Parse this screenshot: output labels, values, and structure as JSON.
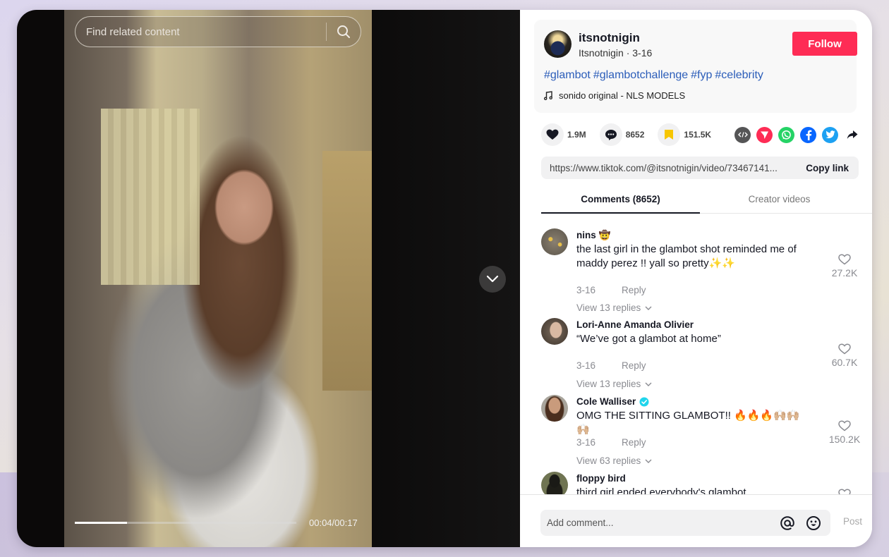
{
  "video": {
    "search_placeholder": "Find related content",
    "time_display": "00:04/00:17",
    "progress_fraction": 0.235
  },
  "post": {
    "author_name": "itsnotnigin",
    "author_sub": "Itsnotnigin · 3-16",
    "follow_label": "Follow",
    "hashtags": [
      "#glambot",
      "#glambotchallenge",
      "#fyp",
      "#celebrity"
    ],
    "music": "sonido original - NLS MODELS"
  },
  "stats": {
    "likes": "1.9M",
    "comments": "8652",
    "saves": "151.5K"
  },
  "share": {
    "icons": [
      "embed-icon",
      "send-to-friends-icon",
      "whatsapp-icon",
      "facebook-icon",
      "twitter-icon",
      "share-arrow-icon"
    ]
  },
  "link": {
    "url": "https://www.tiktok.com/@itsnotnigin/video/73467141...",
    "copy_label": "Copy link"
  },
  "tabs": [
    {
      "label": "Comments (8652)",
      "active": true
    },
    {
      "label": "Creator videos",
      "active": false
    }
  ],
  "comments": [
    {
      "user": "nins 🤠",
      "text": "the last girl in the glambot shot reminded me of maddy perez !! yall so pretty✨✨",
      "date": "3-16",
      "reply": "Reply",
      "view_replies": "View 13 replies",
      "likes": "27.2K"
    },
    {
      "user": "Lori-Anne Amanda Olivier",
      "text": "“We’ve got a glambot at home”",
      "date": "3-16",
      "reply": "Reply",
      "view_replies": "View 13 replies",
      "likes": "60.7K"
    },
    {
      "user": "Cole Walliser",
      "verified": true,
      "text": "OMG THE SITTING GLAMBOT!! 🔥🔥🔥🙌🏼🙌🏼🙌🏼",
      "date": "3-16",
      "reply": "Reply",
      "view_replies": "View 63 replies",
      "likes": "150.2K"
    },
    {
      "user": "floppy bird",
      "text": "third girl ended everybody's glambot"
    }
  ],
  "comment_bar": {
    "placeholder": "Add comment...",
    "post_label": "Post"
  },
  "colors": {
    "brand_red": "#fe2c55",
    "hashtag_blue": "#2b5db9",
    "save_yellow": "#f7c600"
  }
}
